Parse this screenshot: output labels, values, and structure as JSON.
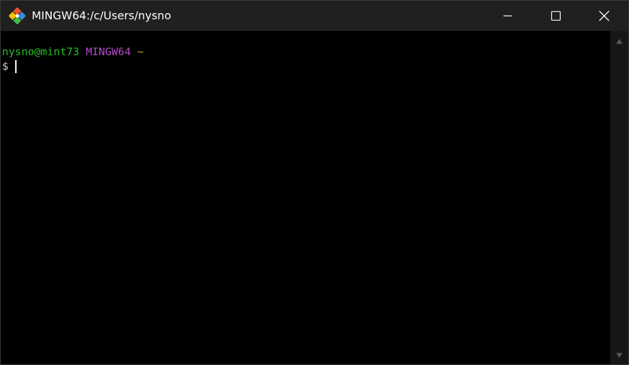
{
  "window": {
    "title": "MINGW64:/c/Users/nysno",
    "app_icon": "git-bash-icon"
  },
  "caption_buttons": {
    "minimize": "minimize-icon",
    "maximize": "maximize-icon",
    "close": "close-icon"
  },
  "terminal": {
    "prompt": {
      "user_host": "nysno@mint73",
      "system": "MINGW64",
      "directory": "~",
      "symbol": "$"
    },
    "colors": {
      "user_host": "#25bc24",
      "system": "#b148c6",
      "directory": "#c7a90e",
      "background": "#000000"
    }
  },
  "scrollbar": {
    "up": "scroll-up-icon",
    "down": "scroll-down-icon"
  }
}
